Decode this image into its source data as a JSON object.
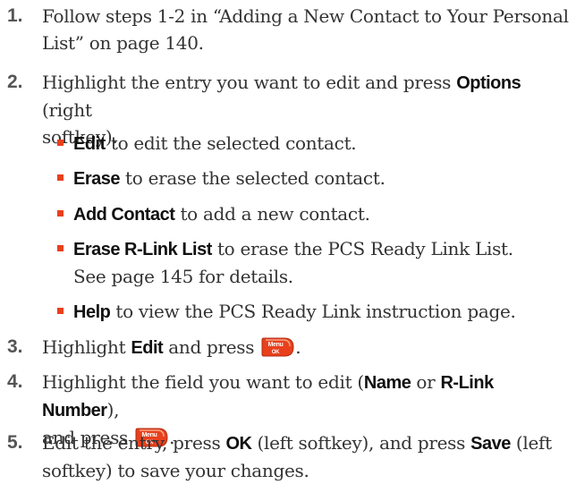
{
  "steps": [
    {
      "number": "1.",
      "lines": [
        "Follow steps 1-2 in “Adding a New Contact to Your Personal",
        "List” on page 140."
      ]
    },
    {
      "number": "2.",
      "a": "Highlight the entry you want to edit and press ",
      "b": "Options",
      "c": " (right",
      "d": "softkey)."
    },
    {
      "number": "3.",
      "a": "Highlight ",
      "b": "Edit",
      "c": " and press "
    },
    {
      "number": "4.",
      "a": "Highlight the field you want to edit (",
      "b": "Name",
      "c": " or ",
      "d": "R-Link Number",
      "e": "),",
      "f": "and press "
    },
    {
      "number": "5.",
      "a": "Edit the entry, press ",
      "b": "OK",
      "c": " (left softkey), and press ",
      "d": "Save",
      "e": " (left",
      "f": "softkey) to save your changes."
    }
  ],
  "options": [
    {
      "key": "Edit",
      "text": " to edit the selected contact."
    },
    {
      "key": "Erase",
      "text": " to erase the selected contact."
    },
    {
      "key": "Add Contact",
      "text": " to add a new contact."
    },
    {
      "key": "Erase R-Link List",
      "text": " to erase the PCS Ready Link List.",
      "continuation": "See page 145 for details."
    },
    {
      "key": "Help",
      "text": " to view the PCS Ready Link instruction page."
    }
  ],
  "menu_key": {
    "icon": "menu-ok-key-icon",
    "line1": "Menu",
    "line2": "OK",
    "color": "#e8401c"
  },
  "colors": {
    "bullet": "#e8401c",
    "number": "#555555",
    "body_text": "#333333"
  }
}
